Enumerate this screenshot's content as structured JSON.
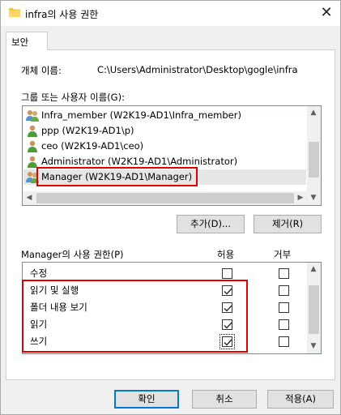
{
  "window": {
    "title": "infra의 사용 권한",
    "close_glyph": "✕"
  },
  "tab": {
    "label": "보안"
  },
  "object": {
    "label": "개체 이름:",
    "value": "C:\\Users\\Administrator\\Desktop\\gogle\\infra"
  },
  "groups": {
    "label": "그룹 또는 사용자 이름(G):",
    "items": [
      {
        "label": "Infra_member (W2K19-AD1\\Infra_member)",
        "icon": "group-icon",
        "selected": false
      },
      {
        "label": "ppp (W2K19-AD1\\p)",
        "icon": "user-icon",
        "selected": false
      },
      {
        "label": "ceo (W2K19-AD1\\ceo)",
        "icon": "user-icon",
        "selected": false
      },
      {
        "label": "Administrator (W2K19-AD1\\Administrator)",
        "icon": "user-icon",
        "selected": false
      },
      {
        "label": "Manager (W2K19-AD1\\Manager)",
        "icon": "group-icon",
        "selected": true
      }
    ]
  },
  "buttons": {
    "add": "추가(D)...",
    "remove": "제거(R)",
    "ok": "확인",
    "cancel": "취소",
    "apply": "적용(A)"
  },
  "permissions": {
    "label": "Manager의 사용 권한(P)",
    "allow_header": "허용",
    "deny_header": "거부",
    "rows": [
      {
        "name": "수정",
        "allow": false,
        "deny": false
      },
      {
        "name": "읽기 및 실행",
        "allow": true,
        "deny": false
      },
      {
        "name": "폴더 내용 보기",
        "allow": true,
        "deny": false
      },
      {
        "name": "읽기",
        "allow": true,
        "deny": false
      },
      {
        "name": "쓰기",
        "allow": true,
        "deny": false
      }
    ]
  },
  "colors": {
    "highlight": "#e00000",
    "accent": "#0078d7"
  }
}
